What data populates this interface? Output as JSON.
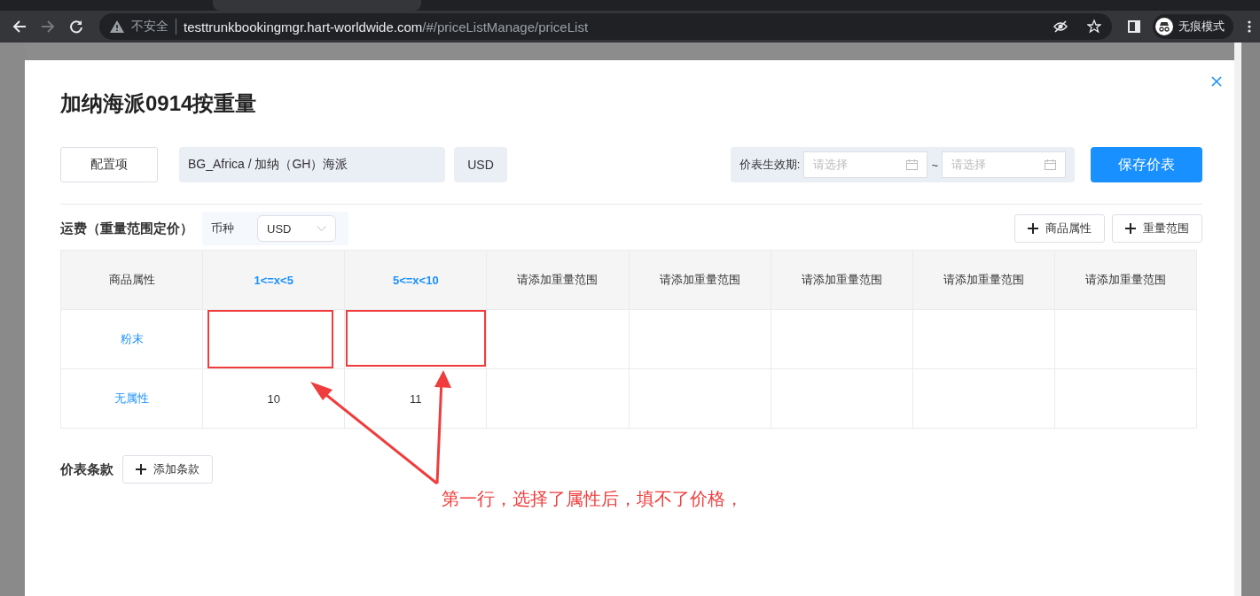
{
  "browser": {
    "security": "不安全",
    "url_host": "testtrunkbookingmgr.hart-worldwide.com",
    "url_path": "/#/priceListManage/priceList",
    "profile": "无痕模式"
  },
  "dialog": {
    "title": "加纳海派0914按重量",
    "config_button": "配置项",
    "route": "BG_Africa / 加纳（GH）海派",
    "currency": "USD",
    "validity": {
      "label": "价表生效期:",
      "start_placeholder": "请选择",
      "separator": "~",
      "end_placeholder": "请选择"
    },
    "save_button": "保存价表",
    "freight": {
      "title": "运费（重量范围定价）",
      "currency_label": "币种",
      "currency_value": "USD",
      "add_buttons": [
        "商品属性",
        "重量范围"
      ]
    },
    "table": {
      "columns": [
        {
          "label": "商品属性",
          "kind": "attribute"
        },
        {
          "label": "1<=x<5",
          "kind": "range"
        },
        {
          "label": "5<=x<10",
          "kind": "range"
        },
        {
          "label": "请添加重量范围",
          "kind": "empty"
        },
        {
          "label": "请添加重量范围",
          "kind": "empty"
        },
        {
          "label": "请添加重量范围",
          "kind": "empty"
        },
        {
          "label": "请添加重量范围",
          "kind": "empty"
        },
        {
          "label": "请添加重量范围",
          "kind": "empty"
        }
      ],
      "rows": [
        {
          "attribute": "粉末",
          "flagged": true,
          "prices": []
        },
        {
          "attribute": "无属性",
          "flagged": false,
          "prices": [
            "10",
            "11"
          ]
        }
      ]
    },
    "terms": {
      "title": "价表条款",
      "add_button": "添加条款"
    },
    "annotation": "第一行，选择了属性后，填不了价格，"
  }
}
